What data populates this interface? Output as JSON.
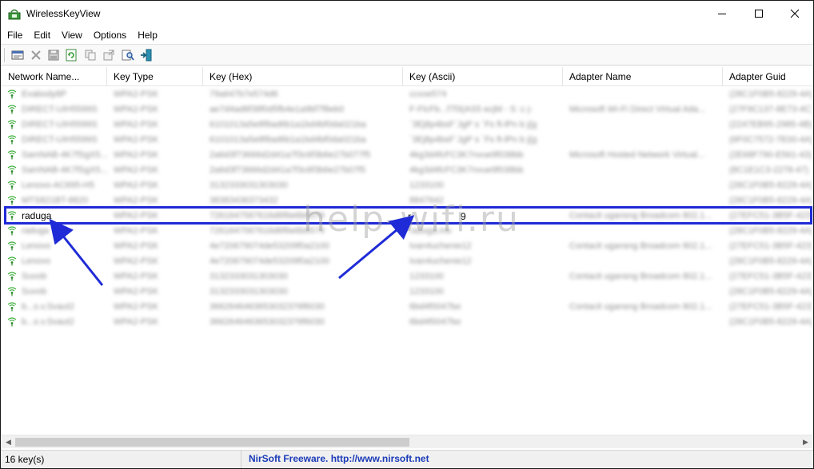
{
  "window": {
    "title": "WirelessKeyView"
  },
  "menu": [
    "File",
    "Edit",
    "View",
    "Options",
    "Help"
  ],
  "toolbar": {
    "icons": [
      "properties-icon",
      "delete-icon",
      "save-icon",
      "refresh-icon",
      "copy-icon",
      "export-icon",
      "find-icon",
      "exit-icon"
    ]
  },
  "table": {
    "columns": [
      "Network Name...",
      "Key Type",
      "Key (Hex)",
      "Key (Ascii)",
      "Adapter Name",
      "Adapter Guid"
    ],
    "highlighted_row": {
      "network_name": "raduga",
      "key_ascii_prefix": "r",
      "key_ascii_suffix": "9"
    },
    "rows": [
      {
        "name": "Evabody8P",
        "type": "WPA2-PSK",
        "hex": "79a647b7e574d6",
        "ascii": "ccxxe574",
        "adapter": "",
        "guid": "(28C1F0B5-8229-4A)"
      },
      {
        "name": "DIRECT-UIH5599S",
        "type": "WPA2-PSK",
        "hex": "ae7d4ad8f38f0d5fb4e1a9bf7f8eb0",
        "ascii": "F-FlcFb...f7f3(AS5 ecjM - S :c j-",
        "adapter": "Microsoft Wi-Fi Direct Virtual Ada...",
        "guid": "(27F9C137-8E73-4C)"
      },
      {
        "name": "DIRECT-UIH5599S",
        "type": "WPA2-PSK",
        "hex": "6101013a5e8f8ad6b1a1bd4bf0da021ba",
        "ascii": "`3Ej8p4bsF`JgP s `Fs ft-lPn b j{g",
        "adapter": "",
        "guid": "(2247EB95-2985-4B)"
      },
      {
        "name": "DIRECT-UIH5599S",
        "type": "WPA2-PSK",
        "hex": "6101013a5e8f8ad6b1a1bd4bf0da021ba",
        "ascii": "`3Ej8p4bsF`JgP s `Fs ft-lPn b j{g",
        "adapter": "",
        "guid": "(6F0C7572-7E00-4A)"
      },
      {
        "name": "SamNAB-4K7fSgX5...",
        "type": "WPA2-PSK",
        "hex": "2a6d3f73666d2d41a7f3c6f3b6e27b077f5",
        "ascii": "4kg3d4fcFC3K7nvue9f038bb",
        "adapter": "Microsoft Hosted Network Virtual...",
        "guid": "(2E68F790-E561-43)"
      },
      {
        "name": "SamNAB-4K7fSgX5...",
        "type": "WPA2-PSK",
        "hex": "2a6d3f73666d2d41a7f3c6f3b6e27b07f5",
        "ascii": "4kg3d4fcFC3K7nvue9f038bb",
        "adapter": "",
        "guid": "(8C1E1C3-2278-47)"
      },
      {
        "name": "Lenovo-AC695-H5",
        "type": "WPA2-PSK",
        "hex": "3132333031303030",
        "ascii": "1233100",
        "adapter": "",
        "guid": "(28C1F0B5-8229-4A)"
      },
      {
        "name": "MTS821BT-8820",
        "type": "WPA2-PSK",
        "hex": "38383436373432",
        "ascii": "8847642",
        "adapter": "",
        "guid": "(28C1F0B5-8229-4A)"
      },
      {
        "name": "raduga",
        "type": "WPA2-PSK",
        "hex": "7261647567616d6f6e6b6579",
        "ascii": "r",
        "adapter": "Contacit ugansng Broadcom 802.1...",
        "guid": "(27EFC51-3B5F-423)"
      },
      {
        "name": "raduga",
        "type": "WPA2-PSK",
        "hex": "7261647567616d6f6e6b6579",
        "ascii": "raduga.mo",
        "adapter": "",
        "guid": "(28C1F0B5-8229-4A)"
      },
      {
        "name": "Lenovo",
        "type": "WPA2-PSK",
        "hex": "4e720679074de53209f0a2100",
        "ascii": "Ivan4uchenie12",
        "adapter": "Contacit ugansng Broadcom 802.1...",
        "guid": "(27EFC51-3B5F-423)"
      },
      {
        "name": "Lenovo",
        "type": "WPA2-PSK",
        "hex": "4e720679074de53209f0a2100",
        "ascii": "Ivan4uchenie12",
        "adapter": "",
        "guid": "(28C1F0B5-8229-4A)"
      },
      {
        "name": "Suvob",
        "type": "WPA2-PSK",
        "hex": "3132333031303030",
        "ascii": "1233100",
        "adapter": "Contacit ugansng Broadcom 802.1...",
        "guid": "(27EFC51-3B5F-423)"
      },
      {
        "name": "Suvob",
        "type": "WPA2-PSK",
        "hex": "3132333031303030",
        "ascii": "1233100",
        "adapter": "",
        "guid": "(28C1F0B5-8229-4A)"
      },
      {
        "name": "b...s.v.Svaut2",
        "type": "WPA2-PSK",
        "hex": "3662646463653032376f6030",
        "ascii": "6bd4f0047bo",
        "adapter": "Contacit ugansng Broadcom 802.1...",
        "guid": "(27EFC51-3B5F-423)"
      },
      {
        "name": "b...s.v.Svaut2",
        "type": "WPA2-PSK",
        "hex": "3662646463653032376f6030",
        "ascii": "6bd4f0047bo",
        "adapter": "",
        "guid": "(28C1F0B5-8229-4A)"
      }
    ]
  },
  "watermark": "help-wifi.ru",
  "status": {
    "count": "16 key(s)",
    "credit": "NirSoft Freeware.  http://www.nirsoft.net"
  }
}
